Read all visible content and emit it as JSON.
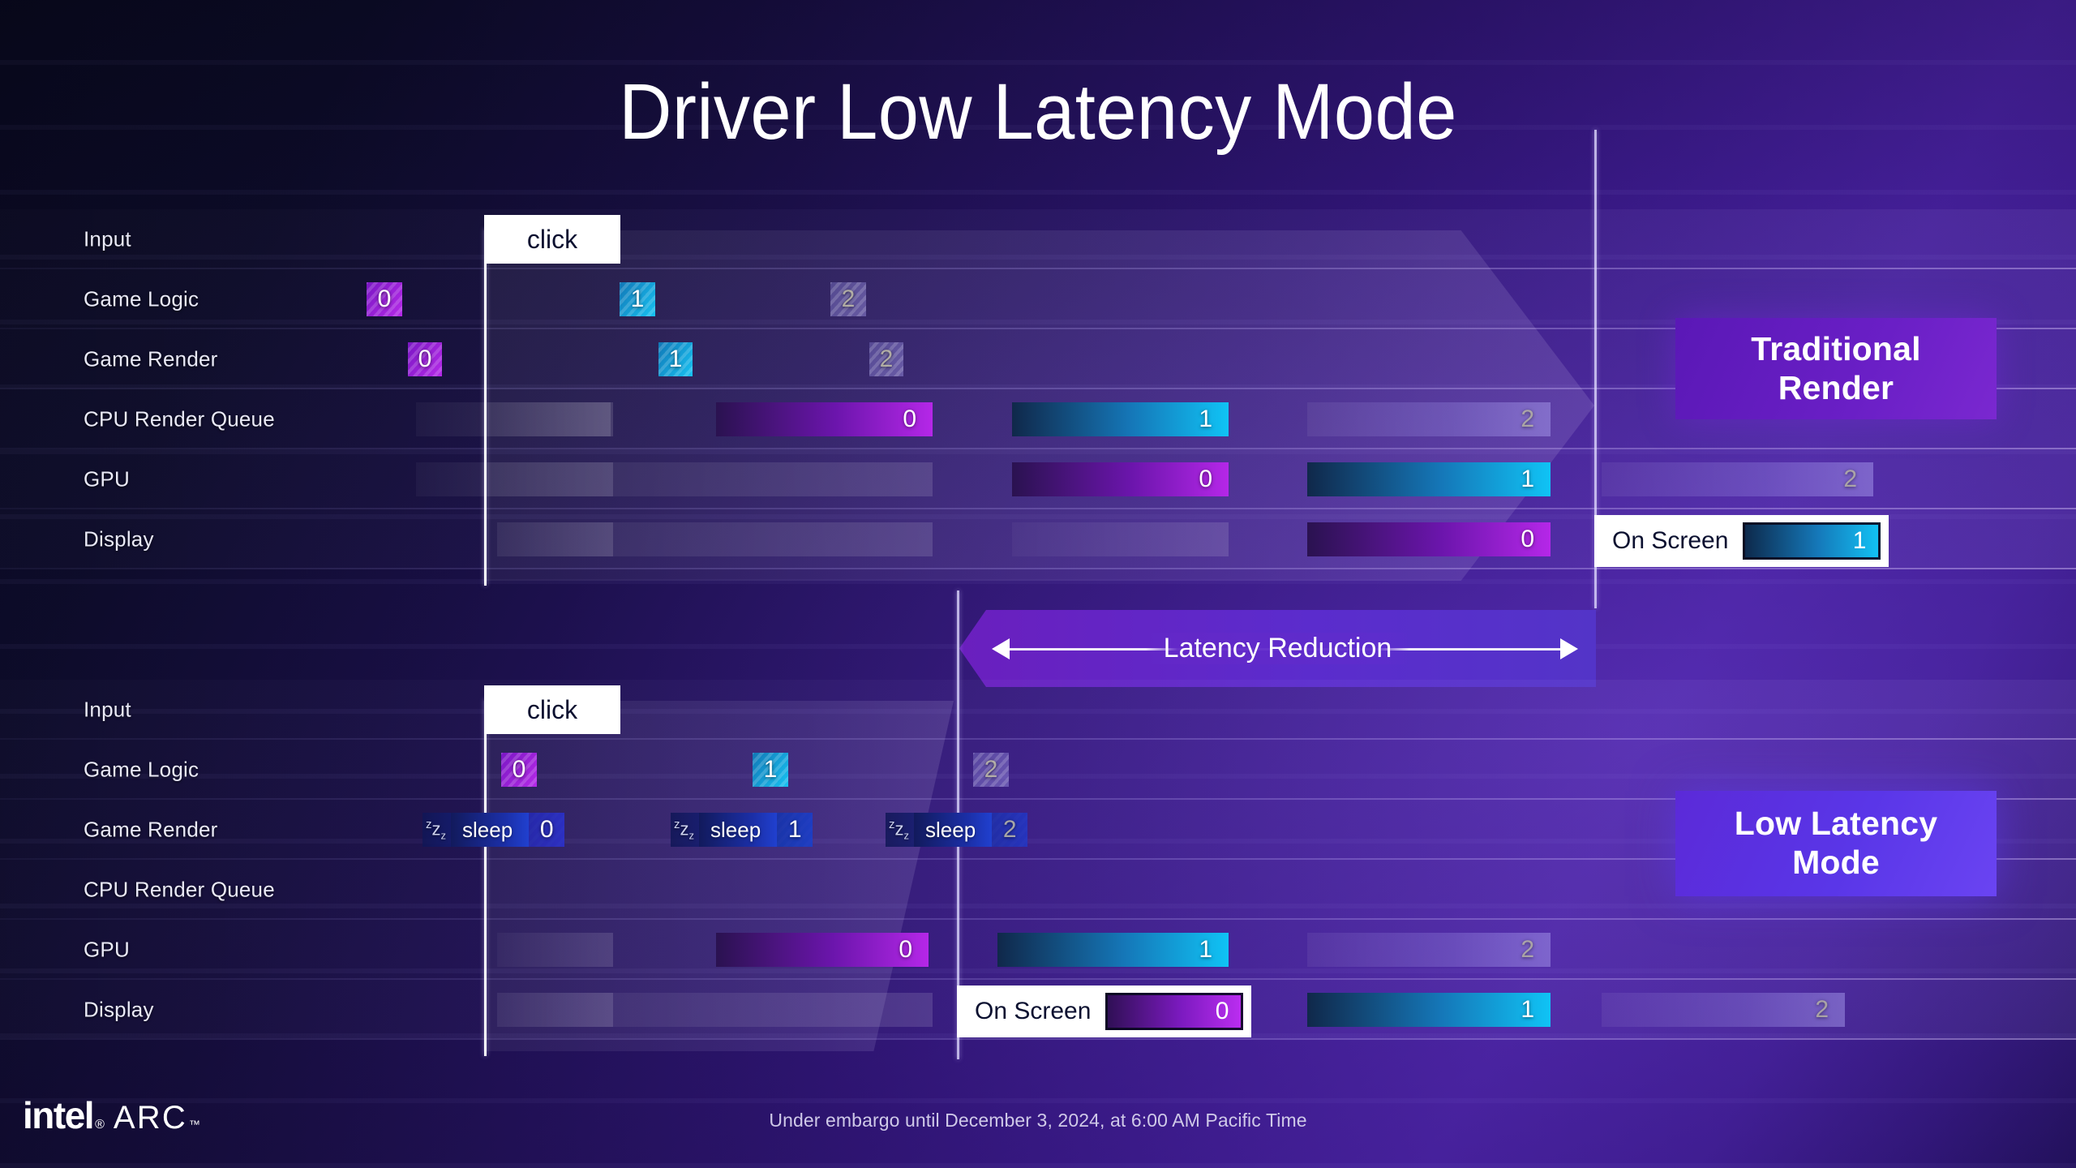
{
  "title": "Driver Low Latency Mode",
  "row_labels": [
    "Input",
    "Game Logic",
    "Game Render",
    "CPU Render Queue",
    "GPU",
    "Display"
  ],
  "click_label": "click",
  "sleep_label": "sleep",
  "sleep_icon": "zzz-icon",
  "on_screen_label": "On Screen",
  "latency_label": "Latency Reduction",
  "badges": {
    "traditional": "Traditional Render",
    "traditional_line1": "Traditional",
    "traditional_line2": "Render",
    "low_latency": "Low Latency Mode",
    "low_latency_line1": "Low Latency",
    "low_latency_line2": "Mode"
  },
  "logo": {
    "brand": "intel",
    "reg": "®",
    "product": "ARC",
    "tm": "™"
  },
  "embargo": "Under embargo until December 3, 2024, at 6:00 AM Pacific Time",
  "colors": {
    "frame0": "#b527e8",
    "frame1": "#10c3f5",
    "frame2": "#a79ef0",
    "badge_traditional": "#6a1fc6",
    "badge_low_latency": "#5a36e8",
    "background_dark": "#080a20",
    "background_violet": "#45209a",
    "accent_white": "#ffffff"
  },
  "chart_data": {
    "type": "timeline",
    "title": "Driver Low Latency Mode",
    "xlabel": "",
    "ylabel": "",
    "grid": true,
    "legend_position": "right",
    "frame_ids": [
      "0",
      "1",
      "2"
    ],
    "charts": [
      {
        "name": "Traditional Render",
        "rows": [
          {
            "label": "Input",
            "items": [
              {
                "kind": "click",
                "text": "click",
                "start": 1.3,
                "end": 1.7
              }
            ]
          },
          {
            "label": "Game Logic",
            "items": [
              {
                "kind": "frame",
                "frame": "0",
                "start": 0.94,
                "end": 1.11
              },
              {
                "kind": "frame",
                "frame": "1",
                "start": 1.64,
                "end": 1.81
              },
              {
                "kind": "frame",
                "frame": "2",
                "start": 2.22,
                "end": 2.39
              }
            ]
          },
          {
            "label": "Game Render",
            "items": [
              {
                "kind": "frame",
                "frame": "0",
                "start": 1.05,
                "end": 1.22
              },
              {
                "kind": "frame",
                "frame": "1",
                "start": 1.76,
                "end": 1.93
              },
              {
                "kind": "frame",
                "frame": "2",
                "start": 2.34,
                "end": 2.51
              }
            ]
          },
          {
            "label": "CPU Render Queue",
            "items": [
              {
                "kind": "ghost",
                "start": 1.13,
                "end": 1.57
              },
              {
                "kind": "ghost",
                "start": 1.27,
                "end": 1.73
              },
              {
                "kind": "frame",
                "frame": "0",
                "start": 1.8,
                "end": 2.42
              },
              {
                "kind": "frame",
                "frame": "1",
                "start": 2.52,
                "end": 3.14
              },
              {
                "kind": "frame",
                "frame": "2",
                "start": 3.24,
                "end": 3.86
              }
            ]
          },
          {
            "label": "GPU",
            "items": [
              {
                "kind": "ghost",
                "start": 1.13,
                "end": 1.57
              },
              {
                "kind": "ghost",
                "start": 1.27,
                "end": 2.42
              },
              {
                "kind": "frame",
                "frame": "0",
                "start": 2.52,
                "end": 3.14
              },
              {
                "kind": "frame",
                "frame": "1",
                "start": 3.24,
                "end": 3.86
              },
              {
                "kind": "frame",
                "frame": "2",
                "start": 3.96,
                "end": 4.6
              }
            ]
          },
          {
            "label": "Display",
            "items": [
              {
                "kind": "ghost",
                "start": 1.13,
                "end": 1.57
              },
              {
                "kind": "ghost",
                "start": 1.27,
                "end": 3.14
              },
              {
                "kind": "frame",
                "frame": "0",
                "start": 3.24,
                "end": 3.86
              },
              {
                "kind": "onscreen",
                "frame": "1",
                "text": "On Screen",
                "start": 3.96,
                "end": 4.7
              }
            ]
          }
        ]
      },
      {
        "name": "Low Latency Mode",
        "rows": [
          {
            "label": "Input",
            "items": [
              {
                "kind": "click",
                "text": "click",
                "start": 1.3,
                "end": 1.7
              }
            ]
          },
          {
            "label": "Game Logic",
            "items": [
              {
                "kind": "frame",
                "frame": "0",
                "start": 1.32,
                "end": 1.49
              },
              {
                "kind": "frame",
                "frame": "1",
                "start": 1.98,
                "end": 2.15
              },
              {
                "kind": "frame",
                "frame": "2",
                "start": 2.55,
                "end": 2.72
              }
            ]
          },
          {
            "label": "Game Render",
            "items": [
              {
                "kind": "sleep",
                "frame": "0",
                "text": "sleep",
                "start": 1.08,
                "end": 1.56
              },
              {
                "kind": "sleep",
                "frame": "1",
                "text": "sleep",
                "start": 1.73,
                "end": 2.21
              },
              {
                "kind": "sleep",
                "frame": "2",
                "text": "sleep",
                "start": 2.3,
                "end": 2.78
              }
            ]
          },
          {
            "label": "CPU Render Queue",
            "items": []
          },
          {
            "label": "GPU",
            "items": [
              {
                "kind": "ghost",
                "start": 1.13,
                "end": 1.57
              },
              {
                "kind": "frame",
                "frame": "0",
                "start": 1.8,
                "end": 2.42
              },
              {
                "kind": "frame",
                "frame": "1",
                "start": 2.52,
                "end": 3.14
              },
              {
                "kind": "frame",
                "frame": "2",
                "start": 3.24,
                "end": 3.86
              }
            ]
          },
          {
            "label": "Display",
            "items": [
              {
                "kind": "ghost",
                "start": 1.13,
                "end": 1.57
              },
              {
                "kind": "ghost",
                "start": 1.27,
                "end": 2.36
              },
              {
                "kind": "onscreen",
                "frame": "0",
                "text": "On Screen",
                "start": 2.38,
                "end": 3.12
              },
              {
                "kind": "frame",
                "frame": "1",
                "start": 3.24,
                "end": 3.86
              },
              {
                "kind": "frame",
                "frame": "2",
                "start": 3.96,
                "end": 4.6
              }
            ]
          }
        ]
      }
    ],
    "annotations": [
      {
        "text": "Latency Reduction",
        "type": "double-arrow"
      }
    ]
  }
}
